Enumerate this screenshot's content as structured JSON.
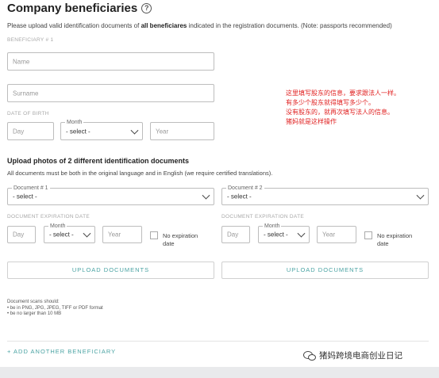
{
  "title": "Company beneficiaries",
  "intro": {
    "prefix": "Please upload valid identification documents of ",
    "bold": "all beneficiares",
    "suffix": " indicated in the registration documents. (Note: passports recommended)"
  },
  "beneficiary_label": "BENEFICIARY # 1",
  "name_placeholder": "Name",
  "surname_placeholder": "Surname",
  "dob_label": "DATE OF BIRTH",
  "day_placeholder": "Day",
  "month_legend": "Month",
  "month_value": "- select -",
  "year_placeholder": "Year",
  "annotation": [
    "这里填写股东的信息，要求跟法人一样。",
    "有多少个股东就得填写多少个。",
    "没有股东的，就再次填写法人的信息。",
    "猪妈就是这样操作"
  ],
  "upload_heading": "Upload photos of 2 different identification documents",
  "upload_sub": "All documents must be both in the original language and in English (we require certified translations).",
  "documents": [
    {
      "legend": "Document # 1",
      "value": "- select -",
      "expiration_label": "DOCUMENT EXPIRATION DATE",
      "day": "Day",
      "month_legend": "Month",
      "month_value": "- select -",
      "year": "Year",
      "no_expiration": "No expiration date",
      "upload_label": "UPLOAD DOCUMENTS"
    },
    {
      "legend": "Document # 2",
      "value": "- select -",
      "expiration_label": "DOCUMENT EXPIRATION DATE",
      "day": "Day",
      "month_legend": "Month",
      "month_value": "- select -",
      "year": "Year",
      "no_expiration": "No expiration date",
      "upload_label": "UPLOAD DOCUMENTS"
    }
  ],
  "requirements": {
    "title": "Document scans should:",
    "items": [
      "be in PNG, JPG, JPEG, TIFF or PDF format",
      "be no larger than 10 MB"
    ]
  },
  "add_beneficiary": "+ ADD ANOTHER BENEFICIARY",
  "watermark": "猪妈跨境电商创业日记",
  "colors": {
    "accent": "#4aa3a3",
    "annotation": "#e02020"
  }
}
